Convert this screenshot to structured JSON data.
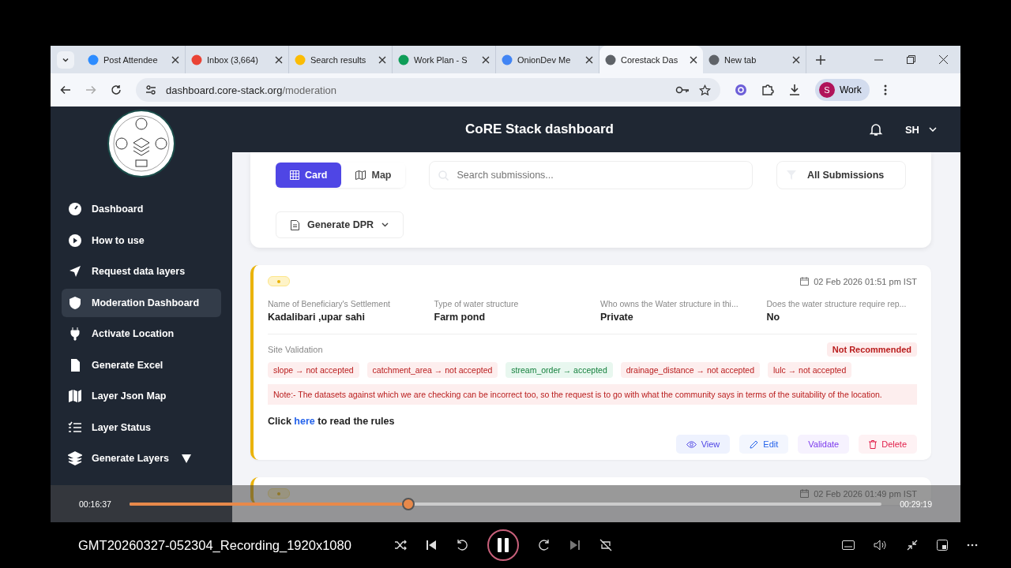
{
  "browser": {
    "tabs": [
      {
        "title": "Post Attendee",
        "selected": false
      },
      {
        "title": "Inbox (3,664)",
        "selected": false
      },
      {
        "title": "Search results",
        "selected": false
      },
      {
        "title": "Work Plan - S",
        "selected": false
      },
      {
        "title": "OnionDev Me",
        "selected": false
      },
      {
        "title": "Corestack Das",
        "selected": true
      },
      {
        "title": "New tab",
        "selected": false
      }
    ],
    "url_host": "dashboard.core-stack.org",
    "url_path": "/moderation",
    "profile_initial": "S",
    "profile_label": "Work"
  },
  "app": {
    "title": "CoRE Stack dashboard",
    "user_initials": "SH",
    "sidebar": {
      "items": [
        {
          "label": "Dashboard",
          "selected": false
        },
        {
          "label": "How to use",
          "selected": false
        },
        {
          "label": "Request data layers",
          "selected": false
        },
        {
          "label": "Moderation Dashboard",
          "selected": true
        },
        {
          "label": "Activate Location",
          "selected": false
        },
        {
          "label": "Generate Excel",
          "selected": false
        },
        {
          "label": "Layer Json Map",
          "selected": false
        },
        {
          "label": "Layer Status",
          "selected": false
        },
        {
          "label": "Generate Layers",
          "selected": false,
          "expandable": true
        }
      ]
    },
    "toolbar": {
      "views": [
        {
          "label": "Card",
          "selected": true
        },
        {
          "label": "Map",
          "selected": false
        }
      ],
      "search": {
        "placeholder": "Search submissions..."
      },
      "filter": "All Submissions",
      "generate": "Generate DPR"
    },
    "submissions": [
      {
        "color": "#eab308",
        "date": "02 Feb 2026 01:51 pm IST",
        "fields": [
          {
            "label": "Name of Beneficiary's Settlement",
            "value": "Kadalibari ,upar sahi"
          },
          {
            "label": "Type of water structure",
            "value": "Farm pond"
          },
          {
            "label": "Who owns the Water structure in thi...",
            "value": "Private"
          },
          {
            "label": "Does the water structure require rep...",
            "value": "No"
          }
        ],
        "validation": {
          "title": "Site Validation",
          "verdict": "Not Recommended",
          "checks": [
            {
              "text": "slope → not accepted",
              "accepted": false
            },
            {
              "text": "catchment_area → not accepted",
              "accepted": false
            },
            {
              "text": "stream_order → accepted",
              "accepted": true
            },
            {
              "text": "drainage_distance → not accepted",
              "accepted": false
            },
            {
              "text": "lulc → not accepted",
              "accepted": false
            }
          ],
          "note": "Note:- The datasets against which we are checking can be incorrect too, so the request is to go with what the community says in terms of the suitability of the location.",
          "rules_before": "Click",
          "rules_link": "here",
          "rules_after": "to read the rules"
        },
        "actions": [
          {
            "label": "View",
            "kind": "view"
          },
          {
            "label": "Edit",
            "kind": "edit"
          },
          {
            "label": "Validate",
            "kind": "validate"
          },
          {
            "label": "Delete",
            "kind": "delete"
          }
        ]
      },
      {
        "date": "02 Feb 2026 01:49 pm IST"
      }
    ]
  },
  "player": {
    "elapsed": "00:16:37",
    "total": "00:29:19",
    "level": 0.364,
    "playing": true,
    "title": "GMT20260327-052304_Recording_1920x1080"
  }
}
